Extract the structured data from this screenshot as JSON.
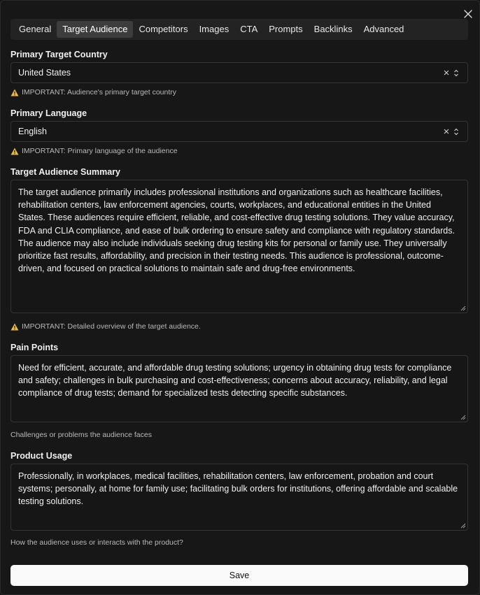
{
  "close_label": "",
  "tabs": [
    {
      "label": "General"
    },
    {
      "label": "Target Audience"
    },
    {
      "label": "Competitors"
    },
    {
      "label": "Images"
    },
    {
      "label": "CTA"
    },
    {
      "label": "Prompts"
    },
    {
      "label": "Backlinks"
    },
    {
      "label": "Advanced"
    }
  ],
  "fields": {
    "country": {
      "label": "Primary Target Country",
      "value": "United States",
      "hint": "IMPORTANT: Audience's primary target country"
    },
    "language": {
      "label": "Primary Language",
      "value": "English",
      "hint": "IMPORTANT: Primary language of the audience"
    },
    "summary": {
      "label": "Target Audience Summary",
      "value": "The target audience primarily includes professional institutions and organizations such as healthcare facilities, rehabilitation centers, law enforcement agencies, courts, workplaces, and educational entities in the United States. These audiences require efficient, reliable, and cost-effective drug testing solutions. They value accuracy, FDA and CLIA compliance, and ease of bulk ordering to ensure safety and compliance with regulatory standards. The audience may also include individuals seeking drug testing kits for personal or family use. They universally prioritize fast results, affordability, and precision in their testing needs. This audience is professional, outcome-driven, and focused on practical solutions to maintain safe and drug-free environments.",
      "hint": "IMPORTANT: Detailed overview of the target audience."
    },
    "pain_points": {
      "label": "Pain Points",
      "value": "Need for efficient, accurate, and affordable drug testing solutions; urgency in obtaining drug tests for compliance and safety; challenges in bulk purchasing and cost-effectiveness; concerns about accuracy, reliability, and legal compliance of drug tests; demand for specialized tests detecting specific substances.",
      "hint": "Challenges or problems the audience faces"
    },
    "product_usage": {
      "label": "Product Usage",
      "value": "Professionally, in workplaces, medical facilities, rehabilitation centers, law enforcement, probation and court systems; personally, at home for family use; facilitating bulk orders for institutions, offering affordable and scalable testing solutions.",
      "hint": "How the audience uses or interacts with the product?"
    }
  },
  "save_label": "Save",
  "colors": {
    "background": "#171717",
    "warning": "#e9b949",
    "button": "#fafafa"
  },
  "icons": [
    "close-icon",
    "warning-icon",
    "clear-icon",
    "chevron-up-down-icon",
    "resize-handle-icon"
  ]
}
